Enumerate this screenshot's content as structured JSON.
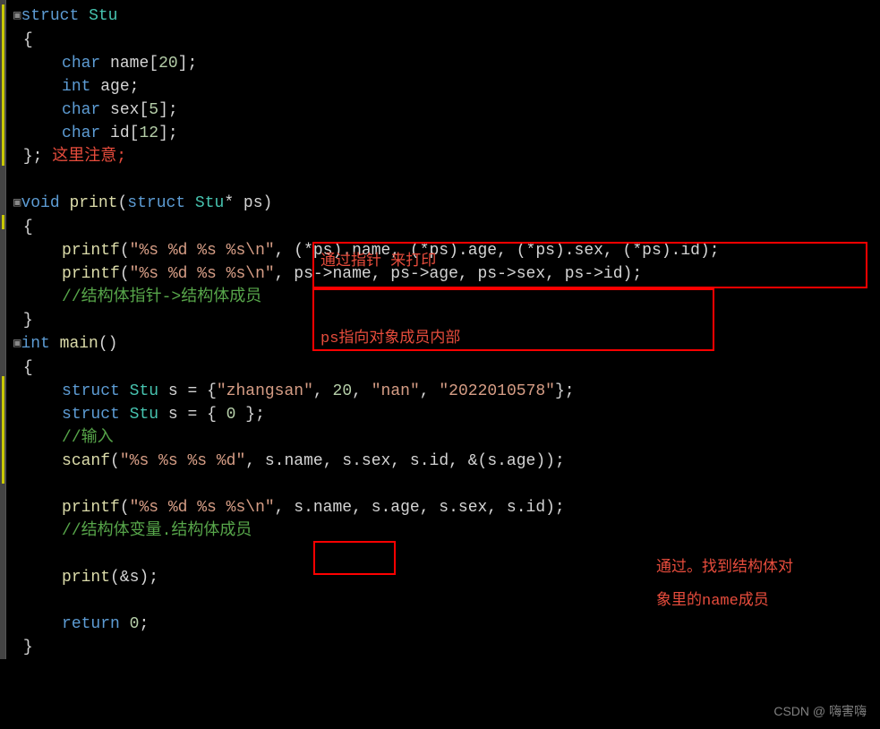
{
  "code": {
    "l1_struct": "struct",
    "l1_name": "Stu",
    "l2_brace": "{",
    "l3_char": "char",
    "l3_name": "name",
    "l3_size": "20",
    "l4_int": "int",
    "l4_age": "age",
    "l5_char": "char",
    "l5_sex": "sex",
    "l5_size": "5",
    "l6_char": "char",
    "l6_id": "id",
    "l6_size": "12",
    "l7_close": "};",
    "l7_note": "这里注意;",
    "l9_void": "void",
    "l9_print": "print",
    "l9_struct": "struct",
    "l9_stu": "Stu",
    "l9_param": "* ps)",
    "l10_brace": "{",
    "l11_printf": "printf",
    "l11_fmt": "\"%s %d %s %s\\n\"",
    "l11_args": ", (*ps).name, (*ps).age, (*ps).sex, (*ps).id);",
    "l12_printf": "printf",
    "l12_fmt": "\"%s %d %s %s\\n\"",
    "l12_args": ", ps->name, ps->age, ps->sex, ps->id);",
    "l13_comment": "//结构体指针->结构体成员",
    "l14_close": "}",
    "l15_int": "int",
    "l15_main": "main",
    "l15_paren": "()",
    "l16_brace": "{",
    "l17_struct": "struct",
    "l17_stu": "Stu",
    "l17_var": "s = {",
    "l17_str1": "\"zhangsan\"",
    "l17_num": "20",
    "l17_str2": "\"nan\"",
    "l17_str3": "\"2022010578\"",
    "l17_end": "};",
    "l18_struct": "struct",
    "l18_stu": "Stu",
    "l18_rest": "s = { ",
    "l18_zero": "0",
    "l18_end": " };",
    "l19_comment": "//输入",
    "l20_scanf": "scanf",
    "l20_fmt": "\"%s %s %s %d\"",
    "l20_args": ", s.name, s.sex, s.id, &(s.age));",
    "l22_printf": "printf",
    "l22_fmt": "\"%s %d %s %s\\n\"",
    "l22_args1": ", s.name, s.age, s.sex, s.id);",
    "l23_comment": "//结构体变量.结构体成员",
    "l25_print": "print",
    "l25_args": "(&s);",
    "l27_return": "return",
    "l27_zero": "0",
    "l28_close": "}"
  },
  "annotations": {
    "box1_line1": "通过指针  来打印",
    "box1_line2": "ps指向对象成员内部",
    "right1": "通过。找到结构体对",
    "right2": "象里的name成员"
  },
  "watermark": "CSDN @   嗨害嗨"
}
